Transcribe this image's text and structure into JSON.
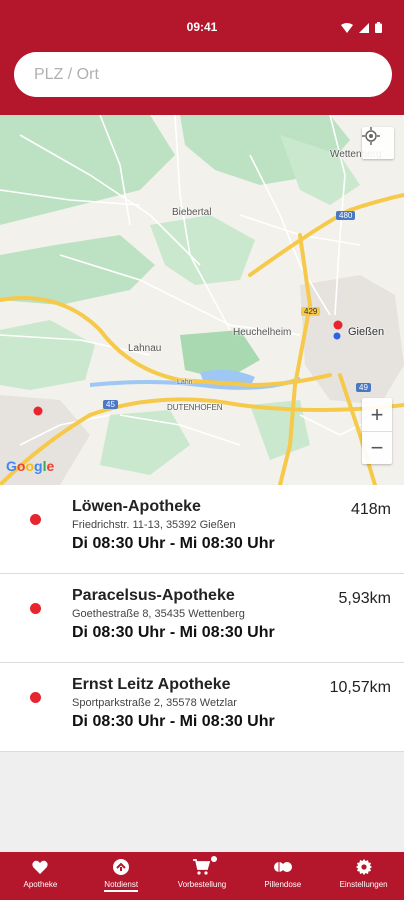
{
  "status_bar": {
    "time": "09:41",
    "icons": [
      "wifi-icon",
      "signal-icon",
      "battery-icon"
    ]
  },
  "search": {
    "placeholder": "PLZ / Ort",
    "value": ""
  },
  "map": {
    "labels": {
      "wettenberg": "Wettenberg",
      "biebertal": "Biebertal",
      "heuchelheim": "Heuchelheim",
      "lahnau": "Lahnau",
      "giessen": "Gießen",
      "dutenhofen": "DUTENHOFEN",
      "lahn": "Lahn",
      "road_480": "480",
      "road_429": "429",
      "road_45": "45",
      "road_49": "49"
    },
    "google": "Google",
    "zoom_in": "+",
    "zoom_out": "−",
    "colors": {
      "land": "#f3f1ec",
      "green": "#bde2c3",
      "road": "#ffffff",
      "highway": "#f6c94a",
      "water": "#9fc7f3"
    }
  },
  "pharmacies": [
    {
      "name": "Löwen-Apotheke",
      "address": "Friedrichstr. 11-13, 35392 Gießen",
      "hours": "Di 08:30 Uhr - Mi 08:30 Uhr",
      "distance": "418m"
    },
    {
      "name": "Paracelsus-Apotheke",
      "address": "Goethestraße 8, 35435 Wettenberg",
      "hours": "Di 08:30 Uhr - Mi 08:30 Uhr",
      "distance": "5,93km"
    },
    {
      "name": "Ernst Leitz Apotheke",
      "address": "Sportparkstraße 2, 35578 Wetzlar",
      "hours": "Di 08:30 Uhr - Mi 08:30 Uhr",
      "distance": "10,57km"
    }
  ],
  "nav": {
    "items": [
      {
        "label": "Apotheke",
        "icon": "heart-icon"
      },
      {
        "label": "Notdienst",
        "icon": "emergency-icon",
        "active": true
      },
      {
        "label": "Vorbestellung",
        "icon": "cart-icon"
      },
      {
        "label": "Pillendose",
        "icon": "pill-icon"
      },
      {
        "label": "Einstellungen",
        "icon": "gear-icon"
      }
    ]
  },
  "theme": {
    "primary": "#b4162b",
    "marker": "#e8242e",
    "marker_blue": "#2a63e8"
  }
}
